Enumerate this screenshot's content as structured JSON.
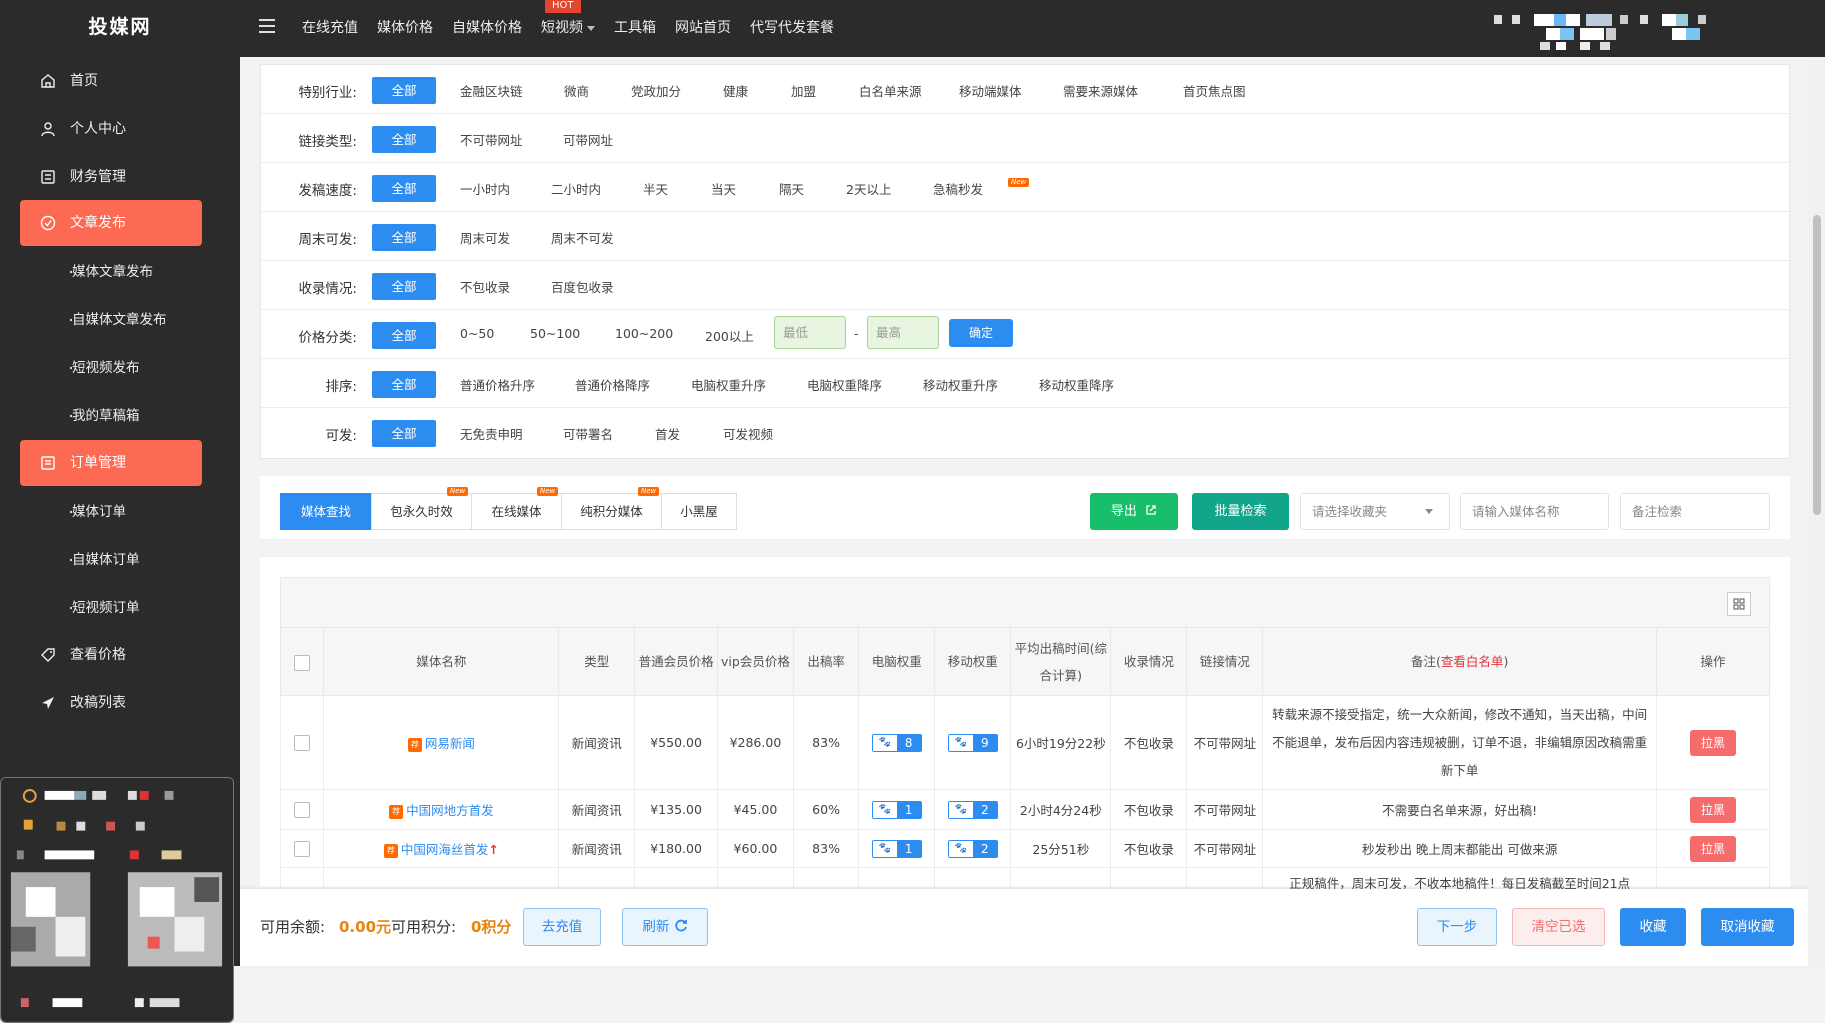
{
  "app": {
    "logo": "投媒网"
  },
  "topnav": [
    {
      "label": "在线充值"
    },
    {
      "label": "媒体价格"
    },
    {
      "label": "自媒体价格"
    },
    {
      "label": "短视频",
      "badge": "HOT"
    },
    {
      "label": "工具箱"
    },
    {
      "label": "网站首页"
    },
    {
      "label": "代写代发套餐"
    }
  ],
  "sidebar": {
    "items": [
      {
        "label": "首页",
        "icon": "home-icon"
      },
      {
        "label": "个人中心",
        "icon": "user-icon"
      },
      {
        "label": "财务管理",
        "icon": "finance-icon"
      },
      {
        "label": "文章发布",
        "icon": "check-circle-icon",
        "active": true
      },
      {
        "label": "媒体文章发布",
        "sub": true
      },
      {
        "label": "自媒体文章发布",
        "sub": true
      },
      {
        "label": "短视频发布",
        "sub": true
      },
      {
        "label": "我的草稿箱",
        "sub": true
      },
      {
        "label": "订单管理",
        "icon": "order-icon",
        "active": true
      },
      {
        "label": "媒体订单",
        "sub": true
      },
      {
        "label": "自媒体订单",
        "sub": true
      },
      {
        "label": "短视频订单",
        "sub": true
      },
      {
        "label": "查看价格",
        "icon": "tag-icon"
      },
      {
        "label": "改稿列表",
        "icon": "send-icon"
      }
    ]
  },
  "filters": {
    "all_label": "全部",
    "new_badge": "New",
    "rows": [
      {
        "label": "特别行业:",
        "options": [
          "金融区块链",
          "微商",
          "党政加分",
          "健康",
          "加盟",
          "白名单来源",
          "移动端媒体",
          "需要来源媒体",
          "首页焦点图"
        ]
      },
      {
        "label": "链接类型:",
        "options": [
          "不可带网址",
          "可带网址"
        ]
      },
      {
        "label": "发稿速度:",
        "options": [
          "一小时内",
          "二小时内",
          "半天",
          "当天",
          "隔天",
          "2天以上",
          "急稿秒发"
        ]
      },
      {
        "label": "周末可发:",
        "options": [
          "周末可发",
          "周末不可发"
        ]
      },
      {
        "label": "收录情况:",
        "options": [
          "不包收录",
          "百度包收录"
        ]
      },
      {
        "label": "价格分类:",
        "options": [
          "0~50",
          "50~100",
          "100~200",
          "200以上"
        ],
        "min_placeholder": "最低",
        "max_placeholder": "最高",
        "dash": "-",
        "confirm": "确定"
      },
      {
        "label": "排序:",
        "options": [
          "普通价格升序",
          "普通价格降序",
          "电脑权重升序",
          "电脑权重降序",
          "移动权重升序",
          "移动权重降序"
        ]
      },
      {
        "label": "可发:",
        "options": [
          "无免责申明",
          "可带署名",
          "首发",
          "可发视频"
        ]
      }
    ]
  },
  "tabs": [
    "媒体查找",
    "包永久时效",
    "在线媒体",
    "纯积分媒体",
    "小黑屋"
  ],
  "toolbar": {
    "export": "导出",
    "batch": "批量检索",
    "folder_placeholder": "请选择收藏夹",
    "name_placeholder": "请输入媒体名称",
    "note_placeholder": "备注检索"
  },
  "table": {
    "headers": [
      "媒体名称",
      "类型",
      "普通会员价格",
      "vip会员价格",
      "出稿率",
      "电脑权重",
      "移动权重",
      "平均出稿时间(综合计算)",
      "收录情况",
      "链接情况",
      "备注",
      "操作"
    ],
    "note_prefix": "备注(",
    "note_link": "查看白名单",
    "note_suffix": ")",
    "action_label": "拉黑",
    "rows": [
      {
        "name": "网易新闻",
        "type": "新闻资讯",
        "price": "¥550.00",
        "vip": "¥286.00",
        "rate": "83%",
        "pc": "8",
        "mobile": "9",
        "time": "6小时19分22秒",
        "index": "不包收录",
        "link": "不可带网址",
        "note": "转载来源不接受指定，统一大众新闻，修改不通知，当天出稿，中间不能退单，发布后因内容违规被删，订单不退，非编辑原因改稿需重新下单"
      },
      {
        "name": "中国网地方首发",
        "type": "新闻资讯",
        "price": "¥135.00",
        "vip": "¥45.00",
        "rate": "60%",
        "pc": "1",
        "mobile": "2",
        "time": "2小时4分24秒",
        "index": "不包收录",
        "link": "不可带网址",
        "note": "不需要白名单来源，好出稿!"
      },
      {
        "name": "中国网海丝首发",
        "type": "新闻资讯",
        "price": "¥180.00",
        "vip": "¥60.00",
        "rate": "83%",
        "pc": "1",
        "mobile": "2",
        "time": "25分51秒",
        "index": "不包收录",
        "link": "不可带网址",
        "note": "秒发秒出 晚上周末都能出 可做来源"
      },
      {
        "name": "",
        "type": "",
        "price": "",
        "vip": "",
        "rate": "",
        "pc": "",
        "mobile": "",
        "time": "",
        "index": "",
        "link": "",
        "note": "正规稿件，周末可发，不收本地稿件！每日发稿截至时间21点"
      }
    ]
  },
  "footer": {
    "balance_label": "可用余额:",
    "balance": "0.00元",
    "points_label": "可用积分:",
    "points": "0积分",
    "recharge": "去充值",
    "refresh": "刷新",
    "next": "下一步",
    "clear": "清空已选",
    "fav": "收藏",
    "unfav": "取消收藏"
  },
  "colors": {
    "primary": "#2d8cf0",
    "accent": "#fd6a53",
    "sidebar": "#2b2b2b"
  }
}
